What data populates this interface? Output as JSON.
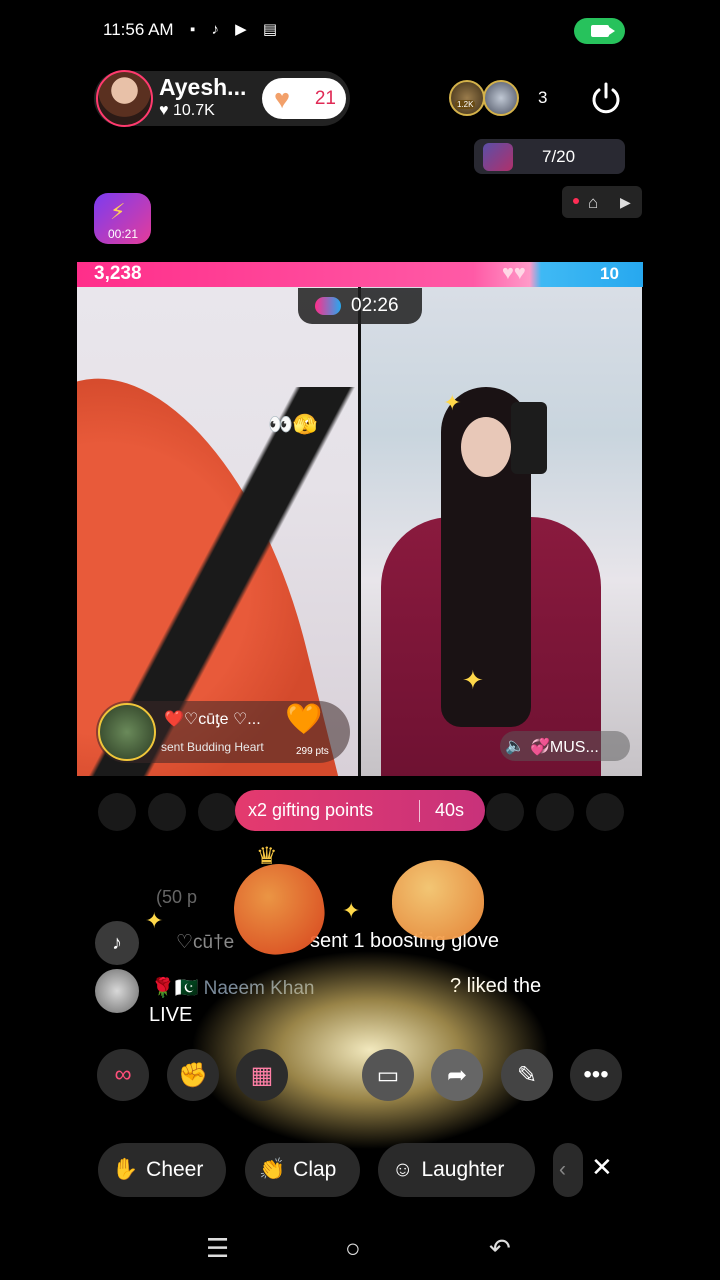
{
  "status_bar": {
    "time": "11:56 AM",
    "icons": [
      "video-record-icon",
      "tiktok-icon",
      "youtube-icon",
      "sim-icon"
    ],
    "camera_indicator_color": "#27c25c"
  },
  "host": {
    "name": "Ayesh...",
    "likes": "♥ 10.7K",
    "follow_count": "21"
  },
  "viewers": {
    "badge": "1.2K",
    "count": "3"
  },
  "rank": {
    "text": "7/20"
  },
  "boost": {
    "timer": "00:21"
  },
  "battle": {
    "left_score": "3,238",
    "right_score": "10",
    "left_color": "#ff2e8a",
    "right_color": "#27a8ef",
    "timer": "02:26"
  },
  "gift_toast": {
    "sender": "❤️♡cūƫe ♡...",
    "message": "sent Budding Heart",
    "points": "299 pts"
  },
  "music": {
    "label": "💞MUS..."
  },
  "points_banner": {
    "label": "x2 gifting points",
    "time": "40s"
  },
  "comments": {
    "faded": "(50 p",
    "item1_name": "♡cū†e",
    "item1_text": "sent 1 boosting glove",
    "item2_name": "🌹🇵🇰 Naeem Khan",
    "item2_text": "? liked the",
    "item2_text_line2": "LIVE"
  },
  "reactions": {
    "cheer": "Cheer",
    "clap": "Clap",
    "laughter": "Laughter"
  }
}
